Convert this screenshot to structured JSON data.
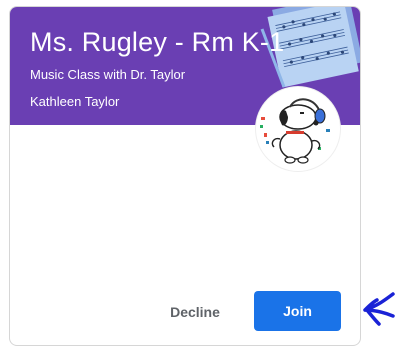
{
  "card": {
    "title": "Ms. Rugley - Rm K-1",
    "section": "Music Class with Dr. Taylor",
    "teacher": "Kathleen Taylor",
    "banner_color": "#6a3fb3",
    "avatar_icon": "snoopy-headphones-icon",
    "banner_image": "sheet-music-icon"
  },
  "actions": {
    "decline_label": "Decline",
    "join_label": "Join",
    "join_color": "#1a73e8"
  },
  "annotation": {
    "arrow_icon": "hand-drawn-arrow-icon",
    "arrow_color": "#1a22d6"
  }
}
